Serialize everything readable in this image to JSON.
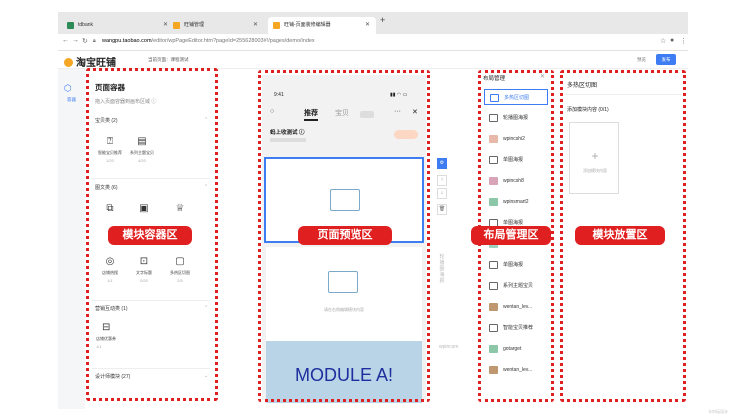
{
  "browser": {
    "tabs": [
      {
        "label": "tdbank",
        "favicon_color": "#2e8b57"
      },
      {
        "label": "旺铺管理",
        "favicon_color": "#f5a623"
      },
      {
        "label": "旺铺-页面装修编辑器",
        "favicon_color": "#f5a623"
      }
    ],
    "new_tab": "+",
    "url_host": "wangpu.taobao.com",
    "url_path": "/editor/wpPageEditor.htm?pageId=25562800​3#!/pages/demo/index"
  },
  "app": {
    "logo_text": "淘宝旺铺",
    "current_page": "当前页面：课程测试",
    "preview": "预览",
    "publish": "发布",
    "rail_label": "容器"
  },
  "left_panel": {
    "title": "页面容器",
    "subtitle": "拖入页面容器到画布区域 ⓘ",
    "groups": [
      {
        "name": "宝贝类 (2)",
        "items": [
          {
            "label": "智能宝贝推荐",
            "count": "1/20",
            "icon": "product-icon"
          },
          {
            "label": "系列主题宝贝",
            "count": "4/20",
            "icon": "series-icon"
          }
        ]
      },
      {
        "name": "图文类 (6)",
        "items": [
          {
            "label": "",
            "count": "",
            "icon": "graphic-icon"
          },
          {
            "label": "",
            "count": "",
            "icon": "image-icon"
          },
          {
            "label": "",
            "count": "",
            "icon": "trophy-icon"
          },
          {
            "label": "店铺热搜",
            "count": "1/1",
            "icon": "hot-search-icon"
          },
          {
            "label": "文字标题",
            "count": "0/20",
            "icon": "text-title-icon"
          },
          {
            "label": "多热区切图",
            "count": "2/5",
            "icon": "hotzone-icon"
          }
        ]
      },
      {
        "name": "营销互动类 (1)",
        "items": [
          {
            "label": "店铺优惠券",
            "count": "1/1",
            "icon": "coupon-icon"
          }
        ]
      },
      {
        "name": "设计师模块 (27)",
        "items": []
      }
    ]
  },
  "phone": {
    "time": "9:41",
    "tabs": [
      "推荐",
      "宝贝"
    ],
    "shop_name": "蚂上收测试 ⓘ",
    "module2_hint": "请在右侧编辑模块内容",
    "module_a_label": "MODULE A!",
    "side_text_1": "轮播图海报",
    "side_text_2": "wpincsm"
  },
  "layout_list": {
    "title": "布局管理",
    "items": [
      {
        "label": "多热区切图",
        "selected": true
      },
      {
        "label": "轮播图海报",
        "selected": false
      },
      {
        "label": "wpincshi2",
        "selected": false
      },
      {
        "label": "单图海报",
        "selected": false
      },
      {
        "label": "wpincsh8",
        "selected": false
      },
      {
        "label": "wpinsmart2",
        "selected": false
      },
      {
        "label": "单图海报",
        "selected": false
      },
      {
        "label": "allelev",
        "selected": false
      },
      {
        "label": "单图海报",
        "selected": false
      },
      {
        "label": "系列主题宝贝",
        "selected": false
      },
      {
        "label": "wentan_lev...",
        "selected": false
      },
      {
        "label": "智能宝贝推荐",
        "selected": false
      },
      {
        "label": "gotarget",
        "selected": false
      },
      {
        "label": "wentan_lev...",
        "selected": false
      }
    ]
  },
  "module_panel": {
    "title": "多热区切图",
    "subtitle": "添加模块内容 (0/1)",
    "add_label": "添加模块内容"
  },
  "annotations": {
    "left": "模块容器区",
    "center": "页面预览区",
    "right_list": "布局管理区",
    "right": "模块放置区"
  },
  "watermark": "卡尔玩设计",
  "colors": {
    "accent": "#3d7cf2",
    "annotation": "#e02020",
    "hero": "#b9d4e6"
  }
}
